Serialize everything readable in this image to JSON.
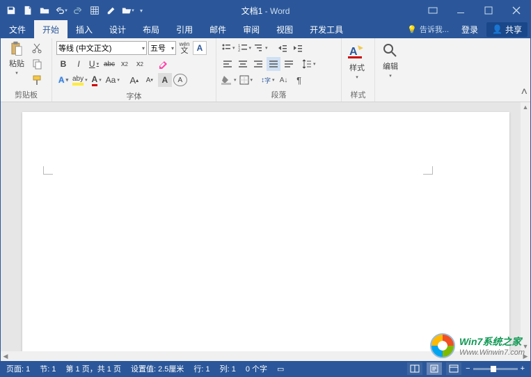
{
  "title": {
    "doc": "文档1",
    "app": "Word"
  },
  "qat": {
    "save": "save",
    "new": "new",
    "open": "open",
    "undo": "undo",
    "redo": "redo",
    "table": "table",
    "edit": "edit",
    "folder": "folder"
  },
  "tabs": {
    "items": [
      "文件",
      "开始",
      "插入",
      "设计",
      "布局",
      "引用",
      "邮件",
      "审阅",
      "视图",
      "开发工具"
    ],
    "active_index": 1,
    "tell_me": "告诉我...",
    "login": "登录",
    "share": "共享"
  },
  "ribbon": {
    "clipboard": {
      "paste": "粘贴",
      "label": "剪贴板"
    },
    "font": {
      "name": "等线 (中文正文)",
      "size": "五号",
      "pinyin": "wén",
      "A_box": "A",
      "bold": "B",
      "italic": "I",
      "underline": "U",
      "strike": "abc",
      "sub": "x₂",
      "sup": "x²",
      "clearfmt": "◇",
      "texteffA": "A",
      "highlight": "aby",
      "fontcolorA": "A",
      "changecase": "Aa",
      "growA": "A",
      "shrinkA": "A",
      "charshade": "A",
      "charborder": "A",
      "label": "字体"
    },
    "paragraph": {
      "label": "段落"
    },
    "styles": {
      "btn": "样式",
      "label": "样式"
    },
    "editing": {
      "btn": "编辑"
    }
  },
  "status": {
    "page_label": "页面:",
    "page_val": "1",
    "section_label": "节:",
    "section_val": "1",
    "pages": "第 1 页，共 1 页",
    "setvalue": "设置值: 2.5厘米",
    "line": "行: 1",
    "col": "列: 1",
    "words": "0 个字",
    "lang": "",
    "zoom": "100%"
  },
  "watermark": {
    "line1": "Win7系统之家",
    "line2": "Www.Winwin7.com"
  }
}
